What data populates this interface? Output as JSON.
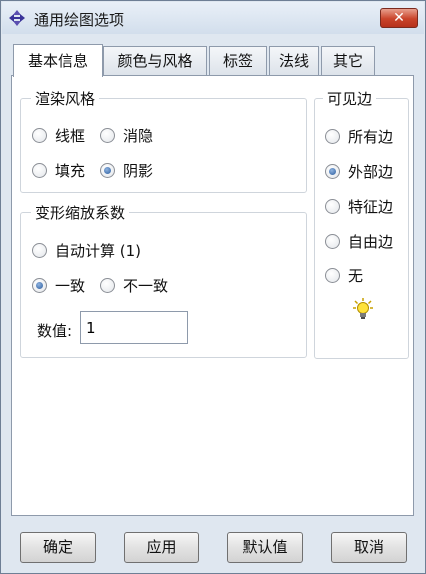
{
  "window": {
    "title": "通用绘图选项",
    "close_label": "✕"
  },
  "tabs": [
    {
      "label": "基本信息",
      "active": true
    },
    {
      "label": "颜色与风格",
      "active": false
    },
    {
      "label": "标签",
      "active": false
    },
    {
      "label": "法线",
      "active": false
    },
    {
      "label": "其它",
      "active": false
    }
  ],
  "render_style": {
    "title": "渲染风格",
    "options": [
      {
        "label": "线框",
        "checked": false
      },
      {
        "label": "消隐",
        "checked": false
      },
      {
        "label": "填充",
        "checked": false
      },
      {
        "label": "阴影",
        "checked": true
      }
    ]
  },
  "deform_scale": {
    "title": "变形缩放系数",
    "options": [
      {
        "label": "自动计算  (1)",
        "checked": false
      },
      {
        "label": "一致",
        "checked": true
      },
      {
        "label": "不一致",
        "checked": false
      }
    ],
    "value_label": "数值:",
    "value": "1"
  },
  "visible_edges": {
    "title": "可见边",
    "options": [
      {
        "label": "所有边",
        "checked": false
      },
      {
        "label": "外部边",
        "checked": true
      },
      {
        "label": "特征边",
        "checked": false
      },
      {
        "label": "自由边",
        "checked": false
      },
      {
        "label": "无",
        "checked": false
      }
    ],
    "hint_icon": "lightbulb-icon"
  },
  "buttons": {
    "ok": "确定",
    "apply": "应用",
    "defaults": "默认值",
    "cancel": "取消"
  }
}
